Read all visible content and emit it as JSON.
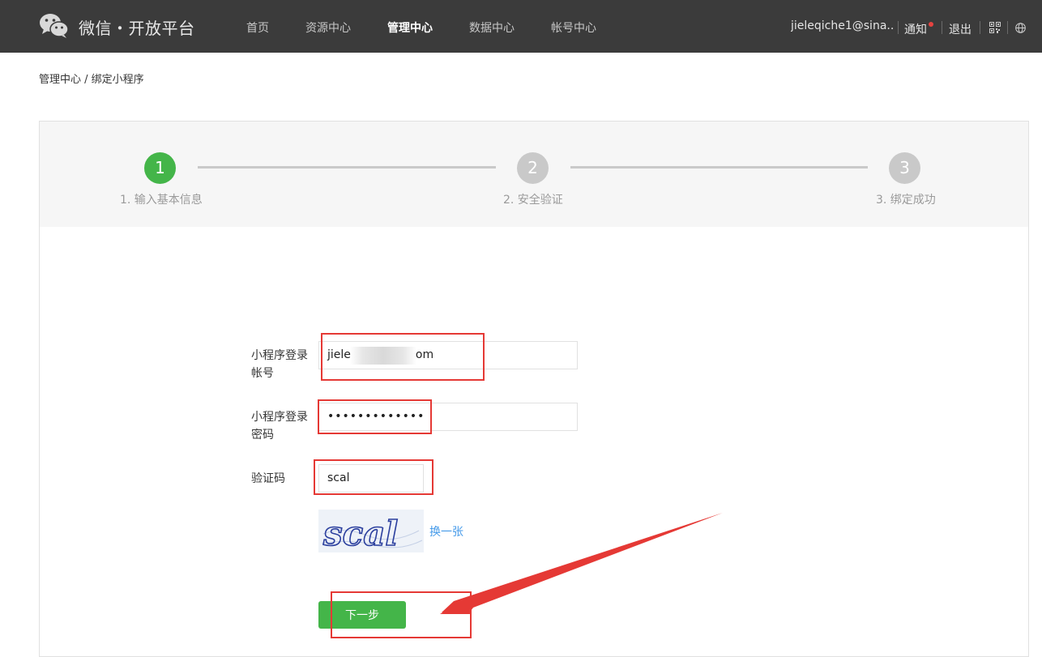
{
  "header": {
    "brand": "微信・开放平台",
    "nav": [
      "首页",
      "资源中心",
      "管理中心",
      "数据中心",
      "帐号中心"
    ],
    "active_nav": "管理中心",
    "user_email": "jieleqiche1@sina...",
    "notify_label": "通知",
    "logout_label": "退出",
    "icons": [
      "wechat-logo-icon",
      "qrcode-icon",
      "globe-icon"
    ]
  },
  "breadcrumb": "管理中心 / 绑定小程序",
  "steps": [
    {
      "num": "1",
      "label": "1. 输入基本信息",
      "status": "active"
    },
    {
      "num": "2",
      "label": "2. 安全验证",
      "status": "pending"
    },
    {
      "num": "3",
      "label": "3. 绑定成功",
      "status": "pending"
    }
  ],
  "form": {
    "account_label_1": "小程序登录",
    "account_label_2": "帐号",
    "account_value": "jiele",
    "account_value_end": "om",
    "password_label_1": "小程序登录",
    "password_label_2": "密码",
    "password_value": "•••••••••••••",
    "captcha_label": "验证码",
    "captcha_value": "scal",
    "captcha_image_text": "scal",
    "change_captcha": "换一张",
    "next_button": "下一步"
  },
  "colors": {
    "topbar": "#3b3b3b",
    "accent_green": "#44b549",
    "link_blue": "#459ae9",
    "annotation_red": "#e53935"
  }
}
